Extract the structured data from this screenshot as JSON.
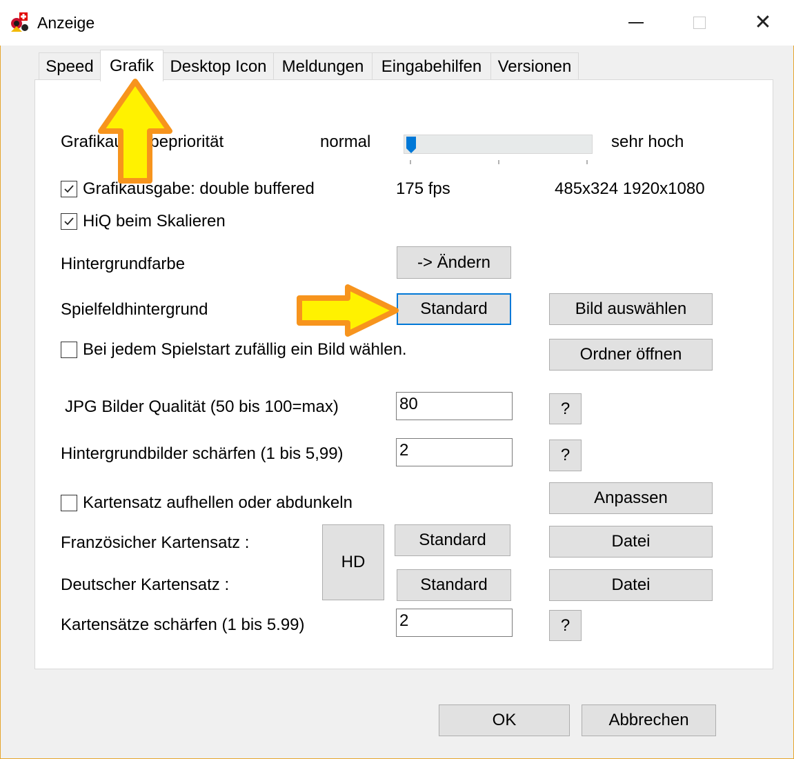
{
  "window": {
    "title": "Anzeige",
    "minimize": "minimize",
    "maximize": "maximize",
    "close": "close"
  },
  "tabs": [
    {
      "label": "Speed"
    },
    {
      "label": "Grafik",
      "active": true
    },
    {
      "label": "Desktop Icon"
    },
    {
      "label": "Meldungen"
    },
    {
      "label": "Eingabehilfen"
    },
    {
      "label": "Versionen"
    }
  ],
  "grafik": {
    "priority_label": "Grafikausgabepriorität",
    "slider_min": "normal",
    "slider_max": "sehr hoch",
    "slider_value": 0,
    "double_buffered_label": "Grafikausgabe: double buffered",
    "double_buffered_checked": true,
    "fps": "175 fps",
    "resolution": "485x324 1920x1080",
    "hiq_label": "HiQ beim Skalieren",
    "hiq_checked": true,
    "bg_color_label": "Hintergrundfarbe",
    "bg_color_button": "-> Ändern",
    "field_bg_label": "Spielfeldhintergrund",
    "standard_button": "Standard",
    "choose_image_button": "Bild auswählen",
    "random_image_label": "Bei jedem Spielstart zufällig ein Bild wählen.",
    "random_image_checked": false,
    "open_folder_button": "Ordner öffnen",
    "jpg_quality_label": "JPG Bilder Qualität (50 bis 100=max)",
    "jpg_quality_value": "80",
    "sharpen_bg_label": "Hintergrundbilder schärfen (1 bis 5,99)",
    "sharpen_bg_value": "2",
    "help_label": "?",
    "cardset_brightness_label": "Kartensatz aufhellen oder abdunkeln",
    "cardset_brightness_checked": false,
    "adjust_button": "Anpassen",
    "french_cardset_label": "Französicher Kartensatz :",
    "german_cardset_label": "Deutscher Kartensatz :",
    "hd_button": "HD",
    "file_button": "Datei",
    "sharpen_cards_label": "Kartensätze schärfen (1 bis 5.99)",
    "sharpen_cards_value": "2"
  },
  "footer": {
    "ok_button": "OK",
    "cancel_button": "Abbrechen"
  },
  "annotations": {
    "arrow_color": "#fff200",
    "arrow_outline": "#f7941d"
  }
}
